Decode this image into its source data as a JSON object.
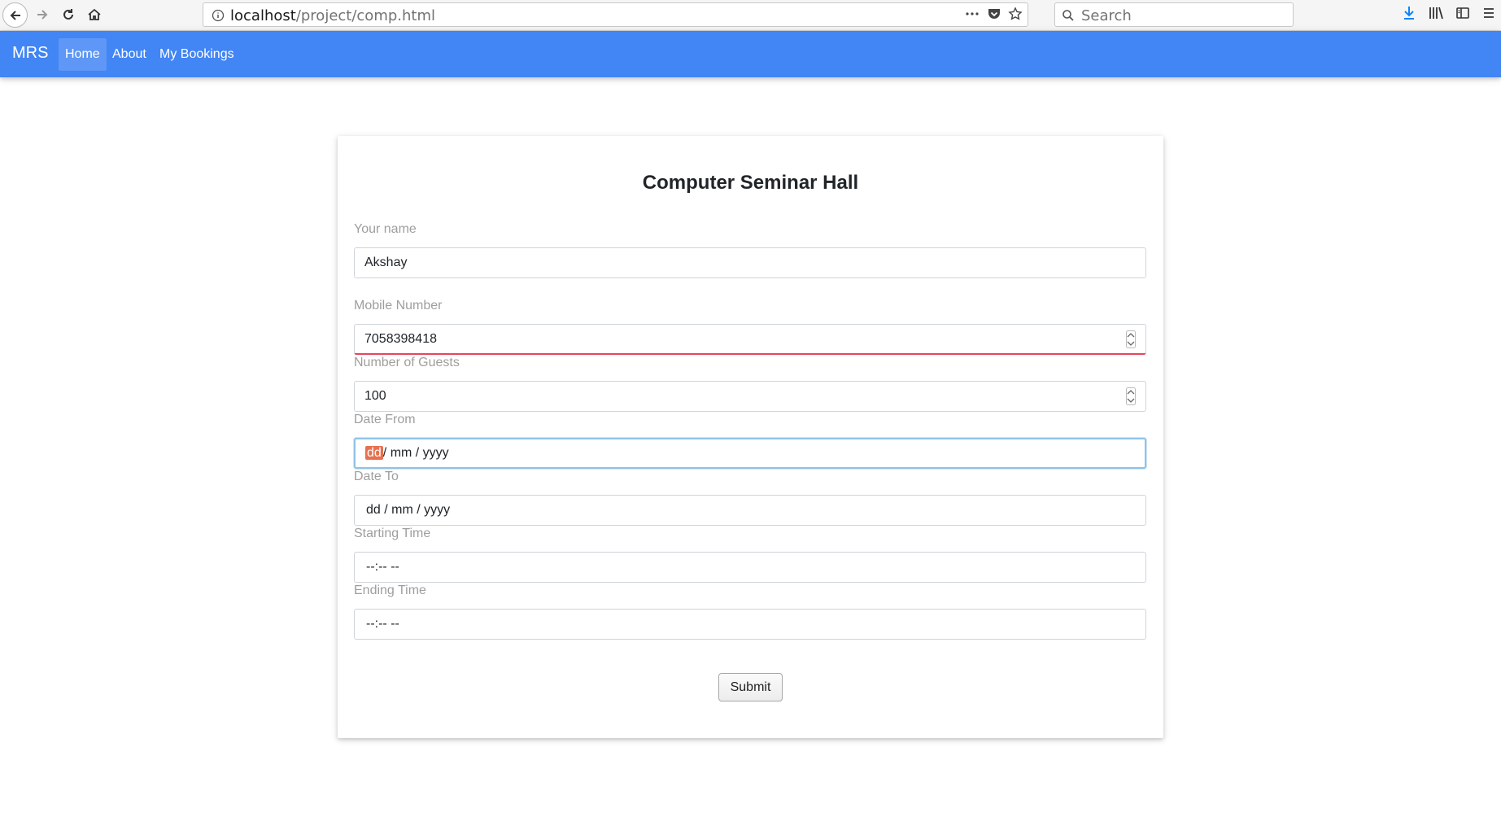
{
  "browser": {
    "url_host": "localhost",
    "url_path": "/project/comp.html",
    "search_placeholder": "Search"
  },
  "navbar": {
    "brand": "MRS",
    "links": [
      {
        "label": "Home",
        "active": true
      },
      {
        "label": "About",
        "active": false
      },
      {
        "label": "My Bookings",
        "active": false
      }
    ]
  },
  "form": {
    "title": "Computer Seminar Hall",
    "name_label": "Your name",
    "name_value": "Akshay",
    "mobile_label": "Mobile Number",
    "mobile_value": "7058398418",
    "guests_label": "Number of Guests",
    "guests_value": "100",
    "date_from_label": "Date From",
    "date_from_dd": "dd",
    "date_from_rest": "/ mm / yyyy",
    "date_to_label": "Date To",
    "date_to_value": "dd / mm / yyyy",
    "start_time_label": "Starting Time",
    "start_time_value": "--:-- --",
    "end_time_label": "Ending Time",
    "end_time_value": "--:-- --",
    "submit_label": "Submit"
  },
  "colors": {
    "navbar": "#4285f4",
    "invalid_underline": "#e8445b",
    "focus_border": "#8ec3e8",
    "date_highlight": "#e8704f"
  }
}
